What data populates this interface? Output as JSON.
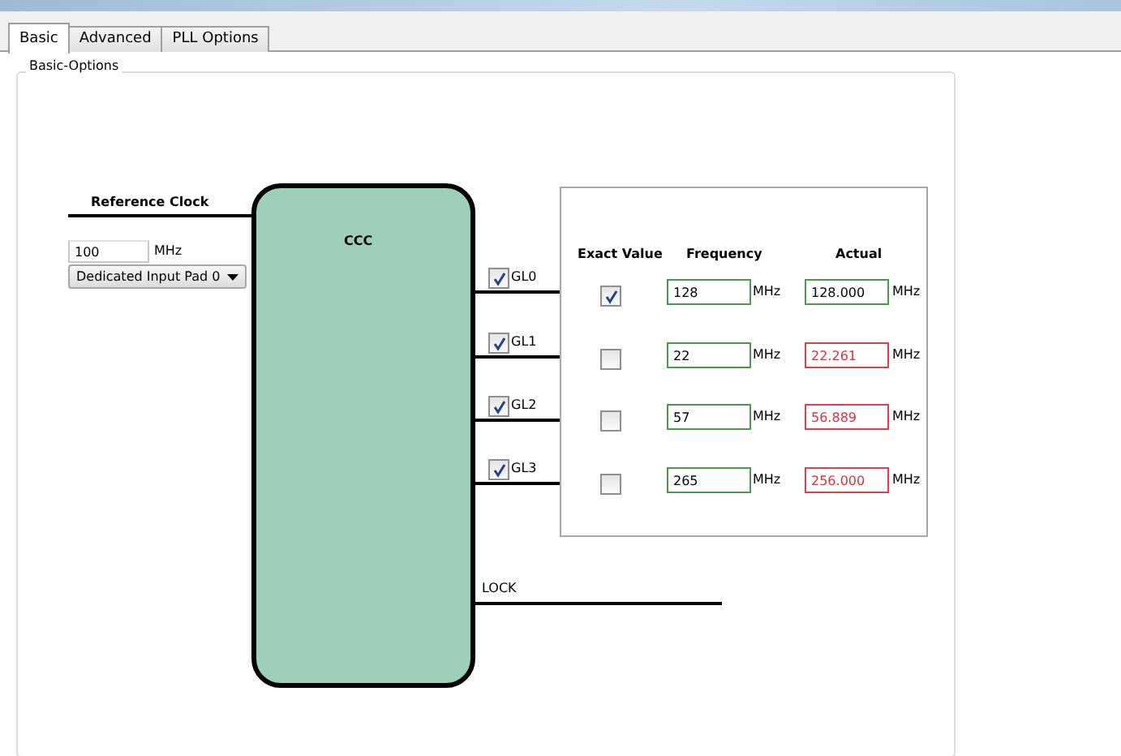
{
  "tabs": [
    {
      "label": "Basic",
      "selected": true
    },
    {
      "label": "Advanced",
      "selected": false
    },
    {
      "label": "PLL Options",
      "selected": false
    }
  ],
  "group": {
    "title": "Basic-Options"
  },
  "reference_clock": {
    "label": "Reference Clock",
    "value": "100",
    "unit": "MHz",
    "source": "Dedicated Input Pad 0"
  },
  "block": {
    "label": "CCC"
  },
  "outputs": [
    {
      "label": "GL0",
      "checked": true
    },
    {
      "label": "GL1",
      "checked": true
    },
    {
      "label": "GL2",
      "checked": true
    },
    {
      "label": "GL3",
      "checked": true
    }
  ],
  "table": {
    "columns": [
      "Exact Value",
      "Frequency",
      "Actual"
    ],
    "rows": [
      {
        "exact": true,
        "frequency": "128",
        "frequency_unit": "MHz",
        "actual": "128.000",
        "actual_unit": "MHz",
        "mismatch": false
      },
      {
        "exact": false,
        "frequency": "22",
        "frequency_unit": "MHz",
        "actual": "22.261",
        "actual_unit": "MHz",
        "mismatch": true
      },
      {
        "exact": false,
        "frequency": "57",
        "frequency_unit": "MHz",
        "actual": "56.889",
        "actual_unit": "MHz",
        "mismatch": true
      },
      {
        "exact": false,
        "frequency": "265",
        "frequency_unit": "MHz",
        "actual": "256.000",
        "actual_unit": "MHz",
        "mismatch": true
      }
    ]
  },
  "lock": {
    "label": "LOCK"
  }
}
